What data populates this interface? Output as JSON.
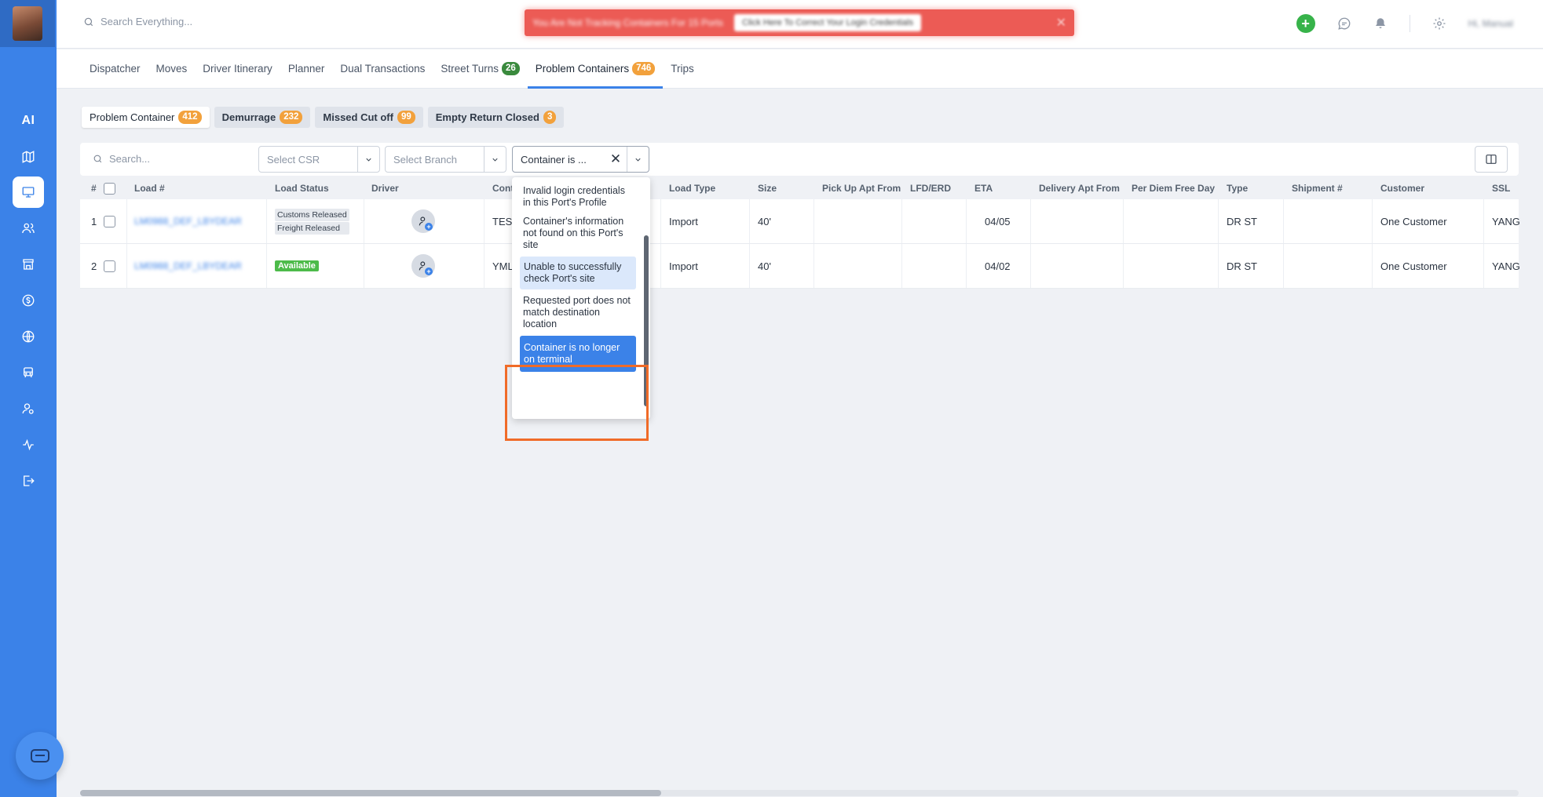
{
  "topbar": {
    "search_placeholder": "Search Everything...",
    "alert_text": "You Are Not Tracking Containers For 15 Ports",
    "alert_button": "Click Here To Correct Your Login Credentials",
    "user_name": "Hi, Manual"
  },
  "sidebar": {
    "ai_label": "AI"
  },
  "tabs": [
    {
      "label": "Dispatcher"
    },
    {
      "label": "Moves"
    },
    {
      "label": "Driver Itinerary"
    },
    {
      "label": "Planner"
    },
    {
      "label": "Dual Transactions"
    },
    {
      "label": "Street Turns",
      "badge": "26"
    },
    {
      "label": "Problem Containers",
      "badge": "746"
    },
    {
      "label": "Trips"
    }
  ],
  "subtabs": [
    {
      "label": "Problem Container",
      "badge": "412"
    },
    {
      "label": "Demurrage",
      "badge": "232"
    },
    {
      "label": "Missed Cut off",
      "badge": "99"
    },
    {
      "label": "Empty Return Closed",
      "badge": "3"
    }
  ],
  "filters": {
    "search_placeholder": "Search...",
    "csr_placeholder": "Select CSR",
    "branch_placeholder": "Select Branch",
    "container_value": "Container is ..."
  },
  "table": {
    "headers": {
      "num": "#",
      "load": "Load #",
      "status": "Load Status",
      "driver": "Driver",
      "container": "Cont",
      "load_type": "Load Type",
      "size": "Size",
      "pickup": "Pick Up Apt From",
      "lfd": "LFD/ERD",
      "eta": "ETA",
      "delivery": "Delivery Apt From",
      "perdiem": "Per Diem Free Day",
      "type": "Type",
      "shipment": "Shipment #",
      "customer": "Customer",
      "ssl": "SSL"
    },
    "rows": [
      {
        "num": "1",
        "load": "LM0988_DEF_LBYDEAR",
        "status": [
          "Customs Released",
          "Freight Released"
        ],
        "container": "TEST",
        "load_type": "Import",
        "size": "40'",
        "eta": "04/05",
        "type": "DR ST",
        "customer": "One Customer",
        "ssl": "YANG"
      },
      {
        "num": "2",
        "load": "LM0988_DEF_LBYDEAR",
        "status": [
          "Available"
        ],
        "container": "YML",
        "load_type": "Import",
        "size": "40'",
        "eta": "04/02",
        "type": "DR ST",
        "customer": "One Customer",
        "ssl": "YANG"
      }
    ]
  },
  "dropdown": {
    "options": [
      "Invalid login credentials in this Port's Profile",
      "Container's information not found on this Port's site",
      "Unable to successfully check Port's site",
      "Requested port does not match destination location",
      "Container is no longer on terminal"
    ]
  },
  "colors": {
    "sidebar": "#3b82e8",
    "accent": "#3b82e8",
    "alert": "#ec5b55",
    "highlight": "#f06b28",
    "badge_orange": "#f2a13c",
    "badge_green": "#3a8a3d"
  }
}
